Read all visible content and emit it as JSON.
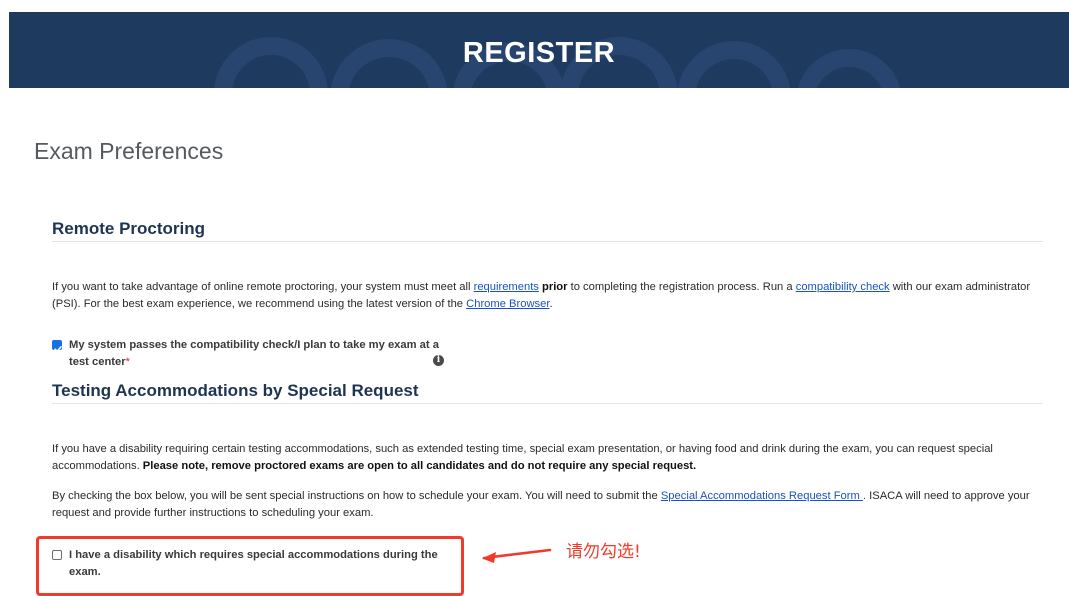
{
  "banner": {
    "title": "REGISTER"
  },
  "page_title": "Exam Preferences",
  "remote": {
    "heading": "Remote Proctoring",
    "p1": "If you want to take advantage of online remote proctoring, your system must meet all ",
    "link_requirements": "requirements",
    "bold_prior": "prior",
    "p2": " to completing the registration process. Run a ",
    "link_compat": "compatibility check",
    "p3": " with our exam administrator (PSI). For the best exam experience, we recommend using the latest version of the ",
    "link_chrome": "Chrome Browser",
    "p4": ".",
    "checkbox": {
      "label": "My system passes the compatibility check/I plan to take my exam at a test center",
      "required_mark": "*",
      "checked": true
    },
    "info_icon": "info-icon"
  },
  "accommodations": {
    "heading": "Testing Accommodations by Special Request",
    "p1": "If you have a disability requiring certain testing accommodations, such as extended testing time, special exam presentation, or having food and drink during the exam, you can request special accommodations. ",
    "p1_bold": "Please note, remove proctored exams are open to all candidates and do not require any special request.",
    "p2a": "By checking the box below, you will be sent special instructions on how to schedule your exam. You will need to submit the ",
    "link_form": "Special Accommodations Request Form ",
    "p2b": ". ISACA will need to approve your request and provide further instructions to scheduling your exam.",
    "checkbox": {
      "label": "I have a disability which requires special accommodations during the exam.",
      "checked": false
    }
  },
  "annotation": {
    "text": "请勿勾选!",
    "color": "#f23a2a"
  },
  "colors": {
    "banner": "#1f3a5f",
    "link": "#1a52c4",
    "heading": "#1d3552",
    "checkbox": "#1a6fe8"
  }
}
